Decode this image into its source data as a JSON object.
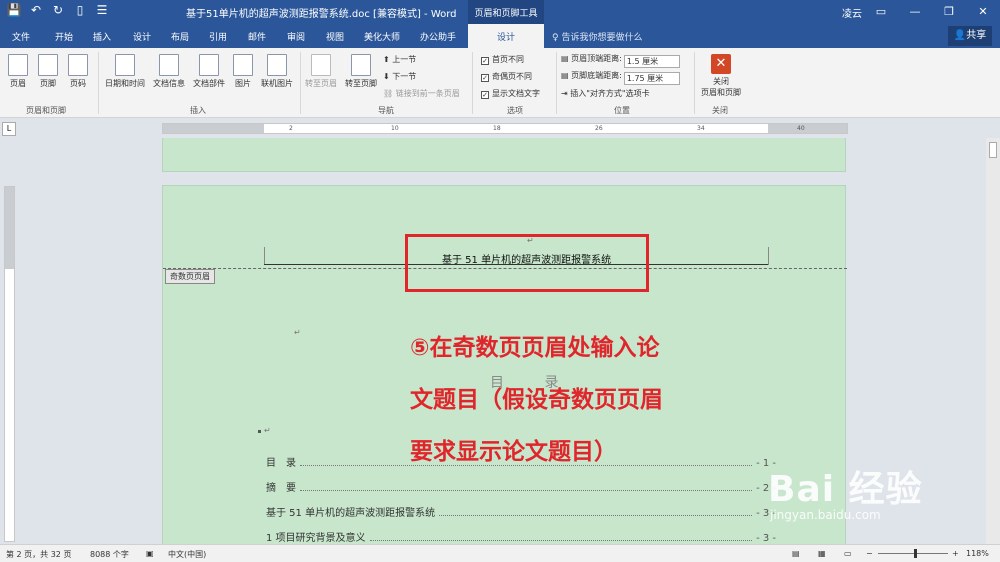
{
  "titlebar": {
    "doc_title": "基于51单片机的超声波测距报警系统.doc [兼容模式] - Word",
    "tool_context": "页眉和页脚工具",
    "user": "凌云",
    "window_buttons": [
      "▭",
      "—",
      "❐",
      "✕"
    ],
    "qat_icons": [
      "save-icon",
      "undo-icon",
      "redo-icon",
      "new-doc-icon",
      "list-icon"
    ]
  },
  "tabs": {
    "items": [
      "文件",
      "开始",
      "插入",
      "设计",
      "布局",
      "引用",
      "邮件",
      "审阅",
      "视图",
      "美化大师",
      "办公助手"
    ],
    "active": "设计",
    "tell_me": "告诉我你想要做什么",
    "share": "共享"
  },
  "ribbon": {
    "header_footer": {
      "header": "页眉",
      "footer": "页脚",
      "page_number": "页码",
      "group": "页眉和页脚"
    },
    "insert": {
      "date_time": "日期和时间",
      "doc_info": "文档信息",
      "doc_parts": "文档部件",
      "picture": "图片",
      "online_picture": "联机图片",
      "group": "插入"
    },
    "nav": {
      "goto_header": "转至页眉",
      "goto_footer": "转至页脚",
      "prev": "上一节",
      "next": "下一节",
      "link_prev": "链接到前一条页眉",
      "group": "导航"
    },
    "options": {
      "diff_first": "首页不同",
      "diff_odd_even": "奇偶页不同",
      "show_text": "显示文档文字",
      "group": "选项"
    },
    "position": {
      "header_top": "页眉顶端距离:",
      "header_top_val": "1.5 厘米",
      "footer_bottom": "页脚底端距离:",
      "footer_bottom_val": "1.75 厘米",
      "insert_align": "插入\"对齐方式\"选项卡",
      "group": "位置"
    },
    "close": {
      "label1": "关闭",
      "label2": "页眉和页脚",
      "group": "关闭"
    }
  },
  "document": {
    "header_text": "基于 51 单片机的超声波测距报警系统",
    "header_label": "奇数页页眉",
    "toc_title": "目 录",
    "toc_rows": [
      {
        "title": "目　录",
        "page": "- 1 -"
      },
      {
        "title": "摘　要",
        "page": "- 2 -"
      },
      {
        "title": "基于 51 单片机的超声波测距报警系统",
        "page": "- 3 -"
      },
      {
        "title": "1  项目研究背景及意义",
        "page": "- 3 -"
      }
    ],
    "annotation": "⑤在奇数页页眉处输入论文题目（假设奇数页页眉要求显示论文题目）"
  },
  "watermark": {
    "brand": "Bai  经验",
    "url": "jingyan.baidu.com"
  },
  "status": {
    "page": "第 2 页，共 32 页",
    "words": "8088 个字",
    "lang": "中文(中国)",
    "zoom": "118%"
  }
}
